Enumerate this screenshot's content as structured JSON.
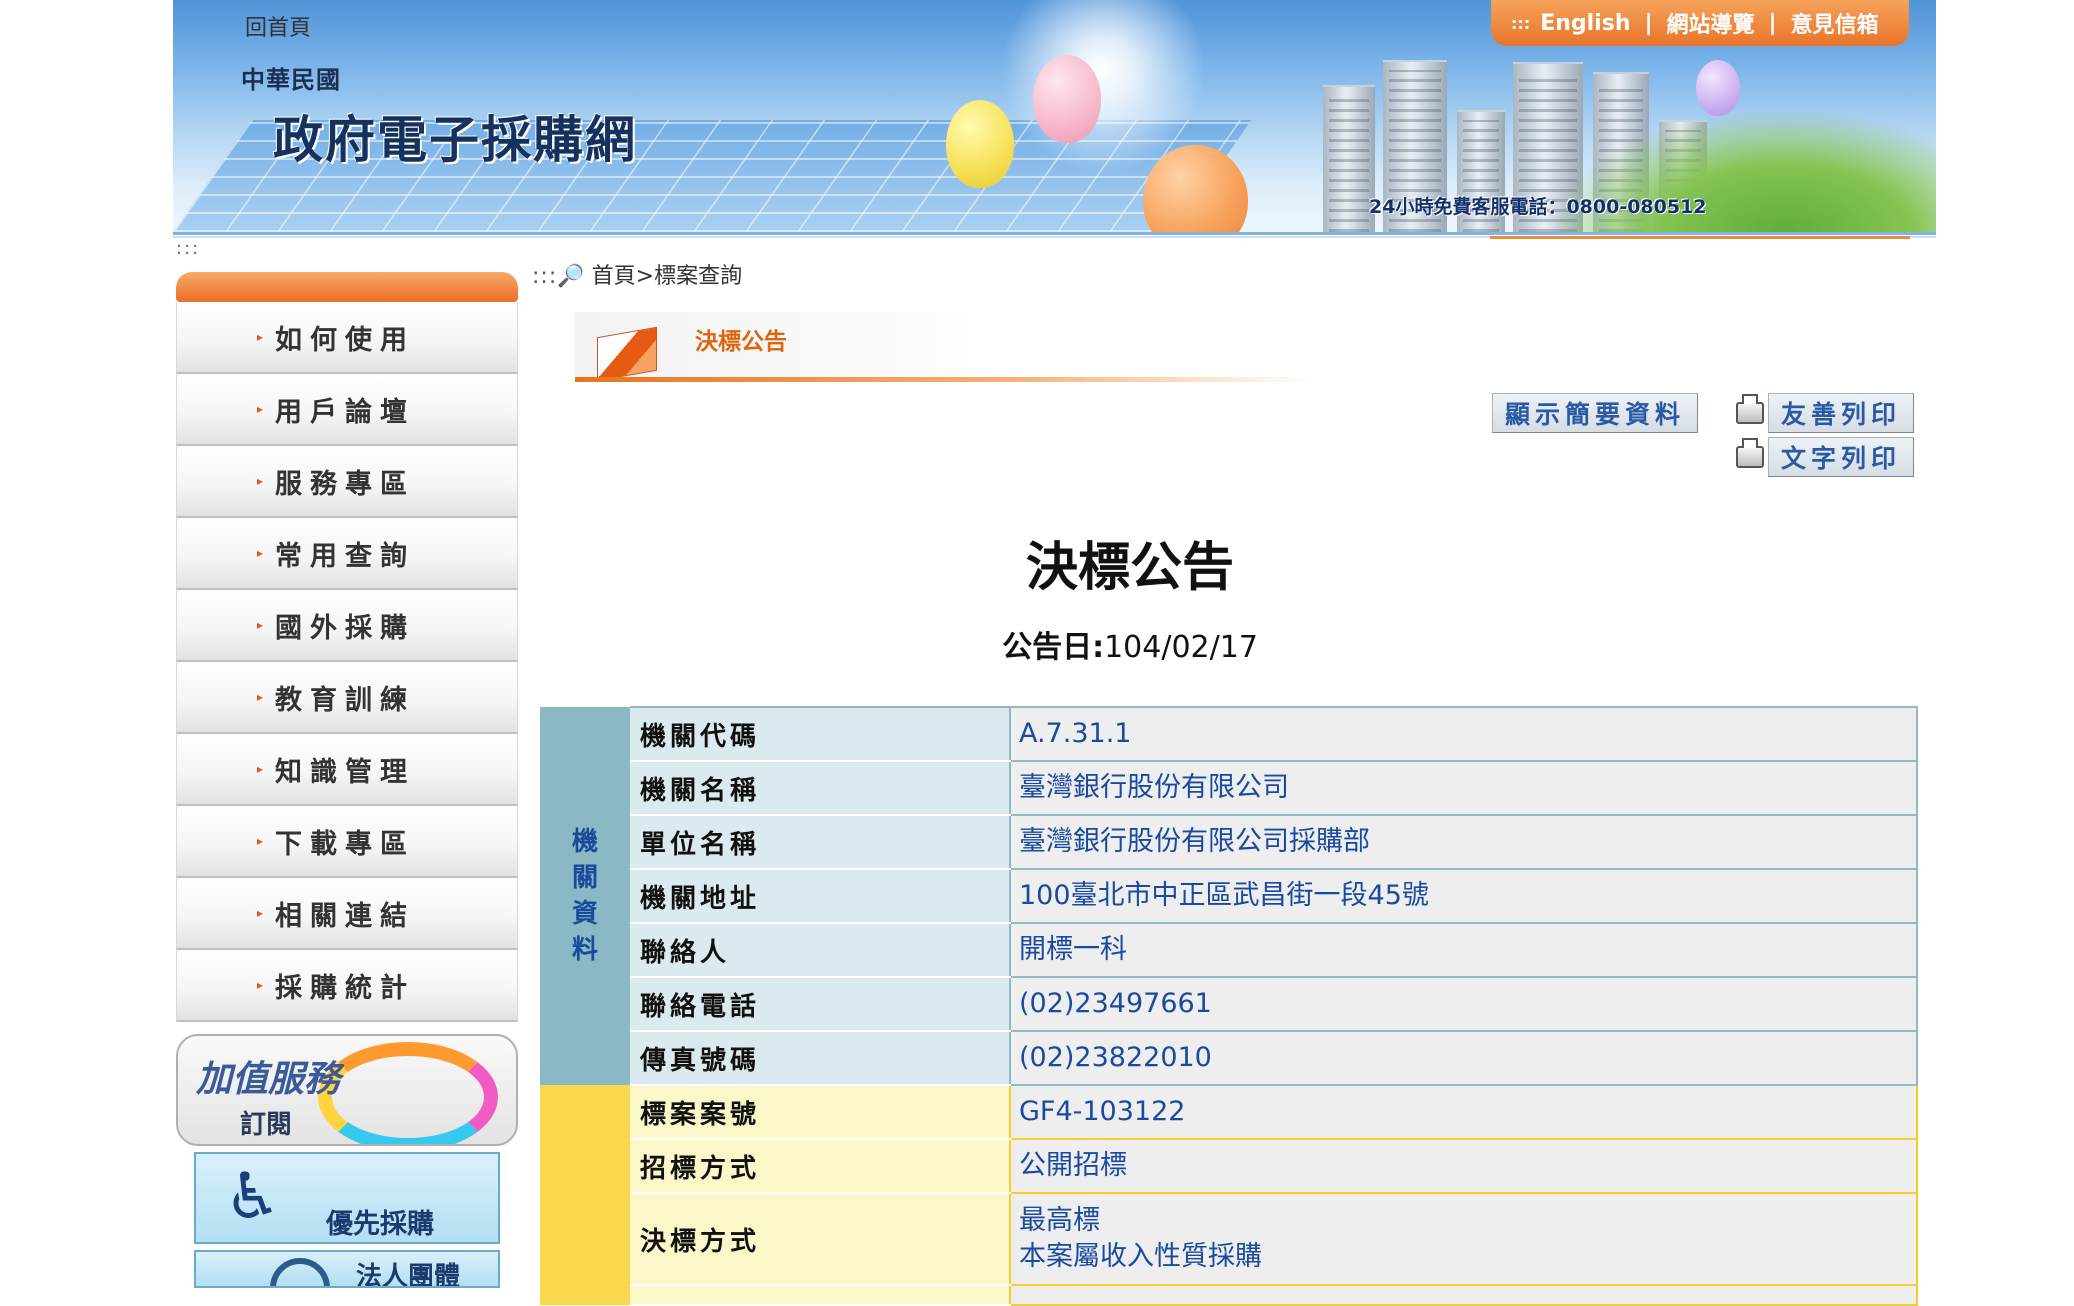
{
  "header": {
    "home_link": "回首頁",
    "site_title_small": "中華民國",
    "site_title": "政府電子採購網",
    "hotline": "24小時免費客服電話：0800-080512",
    "top_links": {
      "english": "English",
      "sitemap": "網站導覽",
      "feedback": "意見信箱"
    }
  },
  "sidebar": {
    "items": [
      {
        "label": "如何使用"
      },
      {
        "label": "用戶論壇"
      },
      {
        "label": "服務專區"
      },
      {
        "label": "常用查詢"
      },
      {
        "label": "國外採購"
      },
      {
        "label": "教育訓練"
      },
      {
        "label": "知識管理"
      },
      {
        "label": "下載專區"
      },
      {
        "label": "相關連結"
      },
      {
        "label": "採購統計"
      }
    ],
    "banners": {
      "addvalue_title": "加值服務",
      "addvalue_sub": "訂閱",
      "priority": "優先採購",
      "legal": "法人團體"
    }
  },
  "breadcrumb": {
    "home": "首頁",
    "separator": ">",
    "current": "標案查詢"
  },
  "section_tab": "決標公告",
  "buttons": {
    "summary": "顯示簡要資料",
    "friendly_print": "友善列印",
    "text_print": "文字列印"
  },
  "document": {
    "title": "決標公告",
    "date_label": "公告日:",
    "date_value": "104/02/17"
  },
  "agency_group": {
    "label": [
      "機",
      "關",
      "資",
      "料"
    ],
    "rows": [
      {
        "field": "機關代碼",
        "value": "A.7.31.1"
      },
      {
        "field": "機關名稱",
        "value": "臺灣銀行股份有限公司"
      },
      {
        "field": "單位名稱",
        "value": "臺灣銀行股份有限公司採購部"
      },
      {
        "field": "機關地址",
        "value": "100臺北市中正區武昌街一段45號"
      },
      {
        "field": "聯絡人",
        "value": "開標一科"
      },
      {
        "field": "聯絡電話",
        "value": "(02)23497661"
      },
      {
        "field": "傳真號碼",
        "value": "(02)23822010"
      }
    ]
  },
  "tender_group": {
    "rows": [
      {
        "field": "標案案號",
        "value": "GF4-103122"
      },
      {
        "field": "招標方式",
        "value": "公開招標"
      },
      {
        "field": "決標方式",
        "value": "最高標",
        "value2": "本案屬收入性質採購"
      }
    ]
  },
  "colors": {
    "accent_orange": "#e8742a",
    "agency_band": "#8ab8c4",
    "tender_band": "#f9d84e",
    "link_blue": "#1a4aa0"
  }
}
